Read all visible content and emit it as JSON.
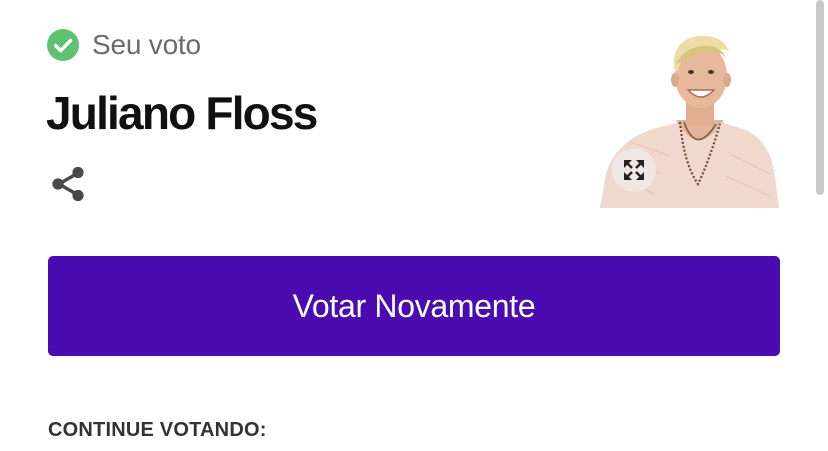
{
  "vote_status": {
    "label": "Seu voto",
    "icon": "check-circle-icon",
    "icon_color": "#5fc271"
  },
  "candidate": {
    "name": "Juliano Floss",
    "photo_icon": "candidate-photo"
  },
  "actions": {
    "share_icon": "share-icon",
    "expand_icon": "expand-icon",
    "vote_again_label": "Votar Novamente",
    "vote_again_color": "#4a0cb0"
  },
  "continue_section": {
    "heading": "CONTINUE VOTANDO:"
  }
}
